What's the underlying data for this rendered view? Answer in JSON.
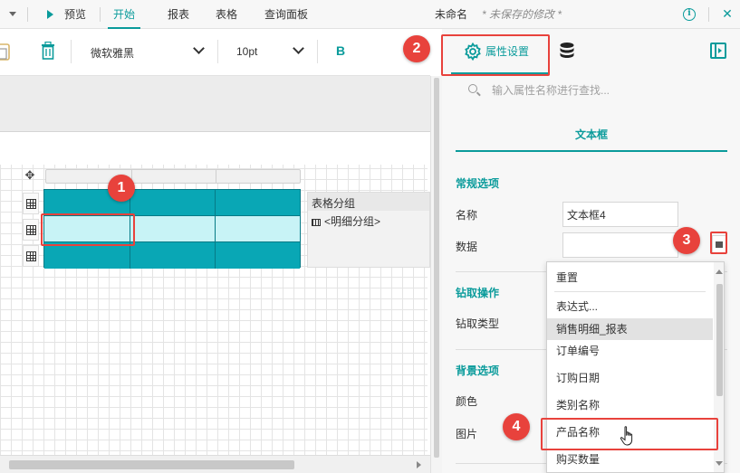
{
  "topbar": {
    "preview_label": "预览",
    "menus": [
      "开始",
      "报表",
      "表格",
      "查询面板"
    ],
    "active_menu": "开始",
    "doc_name": "未命名",
    "unsaved": "* 未保存的修改 *",
    "info_glyph": "i",
    "close_glyph": "✕"
  },
  "toolbar": {
    "font_name": "微软雅黑",
    "font_size": "10pt",
    "bold_label": "B"
  },
  "canvas": {
    "move_glyph": "✥",
    "group_panel": {
      "title": "表格分组",
      "item": "<明细分组>"
    }
  },
  "panel": {
    "tabs": {
      "props_label": "属性设置"
    },
    "search": {
      "placeholder": "输入属性名称进行查找..."
    },
    "section_tab": "文本框",
    "general_heading": "常规选项",
    "name_label": "名称",
    "name_value": "文本框4",
    "data_label": "数据",
    "data_value": "",
    "drill_heading": "钻取操作",
    "drill_type_label": "钻取类型",
    "bg_heading": "背景选项",
    "color_label": "颜色",
    "image_label": "图片"
  },
  "dropdown": {
    "items": [
      "重置",
      "表达式...",
      "销售明细_报表",
      "订单编号",
      "订购日期",
      "类别名称",
      "产品名称",
      "购买数量"
    ],
    "selected": "销售明细_报表"
  },
  "annotations": [
    "1",
    "2",
    "3",
    "4"
  ],
  "colors": {
    "accent": "#0a9b9b",
    "table_teal": "#09a7b5",
    "table_selected": "#c8f3f6",
    "annotation_red": "#e8423c"
  }
}
